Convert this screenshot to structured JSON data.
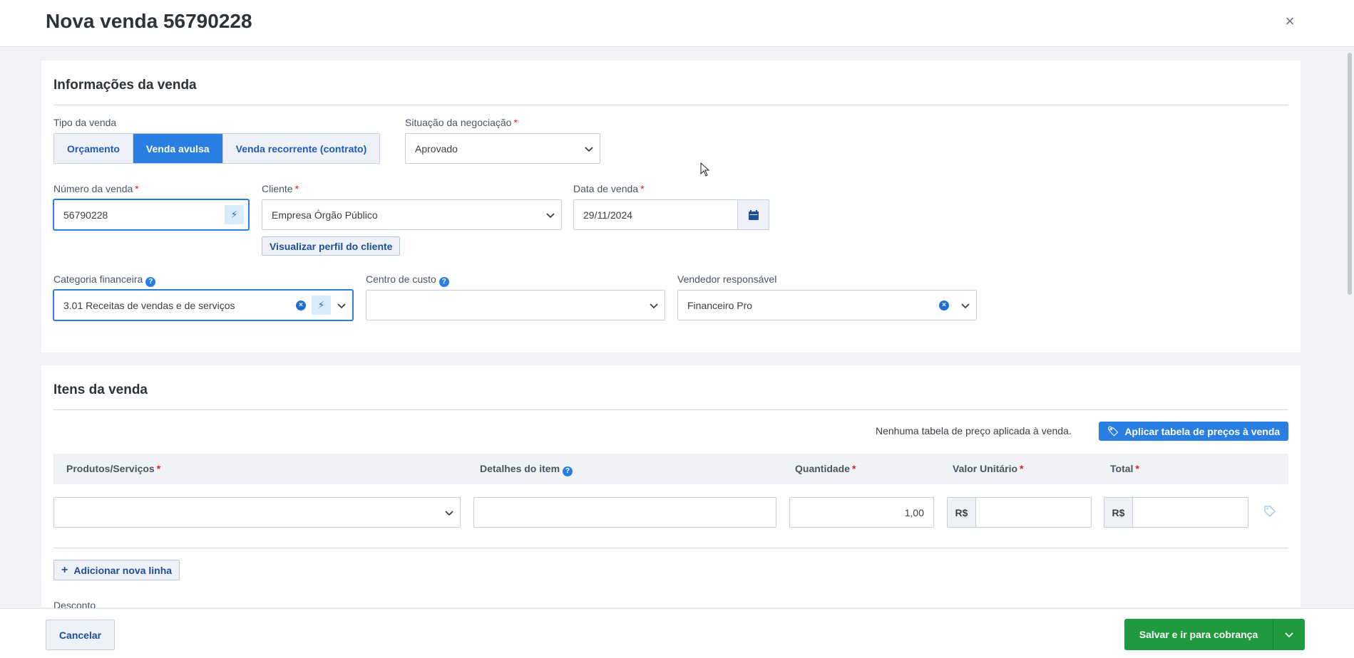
{
  "header": {
    "title": "Nova venda 56790228",
    "close": "×"
  },
  "info": {
    "section_title": "Informações da venda",
    "tipo_label": "Tipo da venda",
    "tipo_options": [
      "Orçamento",
      "Venda avulsa",
      "Venda recorrente (contrato)"
    ],
    "tipo_selected": "Venda avulsa",
    "situacao_label": "Situação da negociação",
    "situacao_value": "Aprovado",
    "numero_label": "Número da venda",
    "numero_value": "56790228",
    "cliente_label": "Cliente",
    "cliente_value": "Empresa Órgão Público",
    "cliente_profile_link": "Visualizar perfil do cliente",
    "data_label": "Data de venda",
    "data_value": "29/11/2024",
    "categoria_label": "Categoria financeira",
    "categoria_value": "3.01 Receitas de vendas e de serviços",
    "centro_label": "Centro de custo",
    "centro_value": "",
    "vendedor_label": "Vendedor responsável",
    "vendedor_value": "Financeiro Pro"
  },
  "items": {
    "section_title": "Itens da venda",
    "price_table_text": "Nenhuma tabela de preço aplicada à venda.",
    "price_table_button": "Aplicar tabela de preços à venda",
    "columns": [
      "Produtos/Serviços",
      "Detalhes do item",
      "Quantidade",
      "Valor Unitário",
      "Total"
    ],
    "row": {
      "produto": "",
      "detalhes": "",
      "quantidade": "1,00",
      "valor_unitario": "",
      "total": "",
      "currency": "R$"
    },
    "add_line": "Adicionar nova linha",
    "desconto_label": "Desconto"
  },
  "footer": {
    "cancel": "Cancelar",
    "save": "Salvar e ir para cobrança"
  },
  "colors": {
    "primary": "#2a7de1",
    "success": "#1f9a3c",
    "required": "#e02020"
  },
  "icons": [
    "close-icon",
    "chevron-down-icon",
    "bolt-icon",
    "calendar-icon",
    "clear-icon",
    "help-icon",
    "tag-icon",
    "plus-icon",
    "mouse-cursor-icon"
  ]
}
